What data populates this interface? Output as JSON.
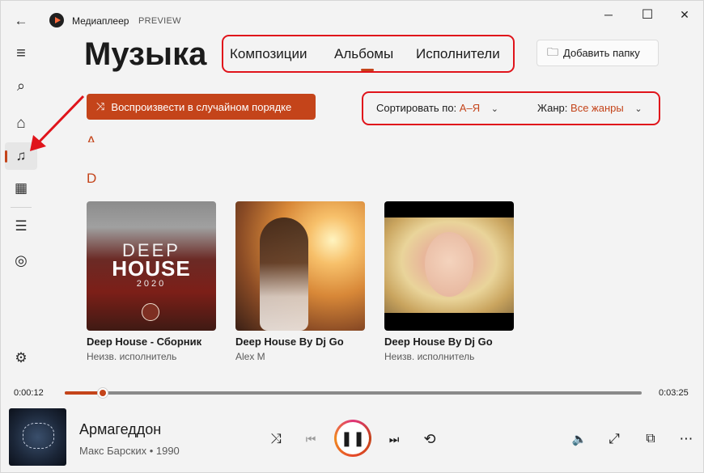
{
  "app": {
    "title": "Медиаплеер",
    "badge": "PREVIEW"
  },
  "window_controls": {
    "minimize": "─",
    "maximize": "☐",
    "close": "✕"
  },
  "sidebar": {
    "items": [
      {
        "icon": "back-icon",
        "glyph": "←"
      },
      {
        "icon": "menu-icon",
        "glyph": "≡"
      },
      {
        "icon": "search-icon",
        "glyph": "⌕"
      },
      {
        "icon": "home-icon",
        "glyph": "⌂"
      },
      {
        "icon": "music-icon",
        "glyph": "♫"
      },
      {
        "icon": "video-icon",
        "glyph": "▦"
      },
      {
        "icon": "playlist-icon",
        "glyph": "☰"
      },
      {
        "icon": "play-queue-icon",
        "glyph": "◎"
      },
      {
        "icon": "settings-icon",
        "glyph": "⚙"
      }
    ]
  },
  "header": {
    "title": "Музыка",
    "tabs": [
      "Композиции",
      "Альбомы",
      "Исполнители"
    ],
    "active_tab": "Альбомы",
    "add_folder": {
      "icon": "folder-add-icon",
      "glyph": "🗀",
      "label": "Добавить папку"
    }
  },
  "toolbar": {
    "shuffle": {
      "icon": "shuffle-icon",
      "glyph": "⤨",
      "label": "Воспроизвести в случайном порядке"
    },
    "sort": {
      "label": "Сортировать по:",
      "value": "А–Я",
      "chevron": "⌄"
    },
    "genre": {
      "label": "Жанр:",
      "value": "Все жанры",
      "chevron": "⌄"
    }
  },
  "groups": [
    "A",
    "D"
  ],
  "albums": [
    {
      "title": "Deep House - Сборник",
      "artist": "Неизв. исполнитель",
      "cover": {
        "line1": "DEEP",
        "line2": "HOUSE",
        "line3": "2020"
      }
    },
    {
      "title": "Deep House By Dj Go",
      "artist": "Alex M"
    },
    {
      "title": "Deep House By Dj Go",
      "artist": "Неизв. исполнитель"
    }
  ],
  "playback": {
    "elapsed": "0:00:12",
    "total": "0:03:25",
    "progress": 0.066,
    "track_title": "Армагеддон",
    "track_sub": "Макс Барских • 1990"
  },
  "controls": {
    "shuffle": "⤨",
    "prev": "⏮",
    "play_pause": "❚❚",
    "next": "⏭",
    "repeat": "⟲",
    "volume": "🔈",
    "fullscreen": "⤢",
    "mini_player": "⧉",
    "more": "⋯"
  },
  "colors": {
    "accent": "#c4441a",
    "annotation": "#e0141b",
    "background": "#f3f3f3"
  }
}
